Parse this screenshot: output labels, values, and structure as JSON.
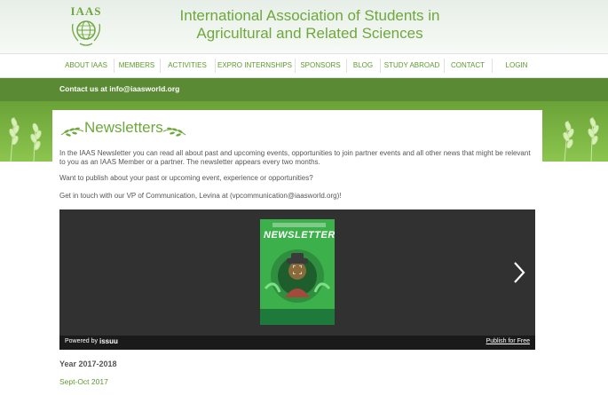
{
  "header": {
    "logo_text": "IAAS",
    "title_line1": "International Association of Students in",
    "title_line2": "Agricultural and Related Sciences"
  },
  "nav": {
    "items": [
      {
        "label": "About IAAS"
      },
      {
        "label": "Members"
      },
      {
        "label": "Activities"
      },
      {
        "label": "ExPro Internships"
      },
      {
        "label": "Sponsors"
      },
      {
        "label": "Blog"
      },
      {
        "label": "Study Abroad"
      },
      {
        "label": "Contact"
      },
      {
        "label": "Login"
      }
    ]
  },
  "contact_bar": {
    "text": "Contact us at info@iaasworld.org"
  },
  "content": {
    "heading": "Newsletters",
    "para1": "In the IAAS Newsletter you can read all about past and upcoming events, opportunities to join partner events and all other news that might be relevant to you as an IAAS Member or a partner. The newsletter appears every two months.",
    "para2": "Want to publish about your past or upcoming event, experience or opportunities?",
    "para3": "Get in touch with our VP of Communication, Levina at (vpcommunication@iaasworld.org)!",
    "embed": {
      "cover_title": "NEWSLETTER",
      "powered_by": "Powered by",
      "brand": "issuu",
      "publish_link": "Publish for Free"
    },
    "year_heading": "Year 2017-2018",
    "month_link": "Sept-Oct 2017"
  },
  "colors": {
    "brand_green": "#6ea83c",
    "dark_green": "#5a8a34",
    "link_green": "#5e9a2e"
  }
}
